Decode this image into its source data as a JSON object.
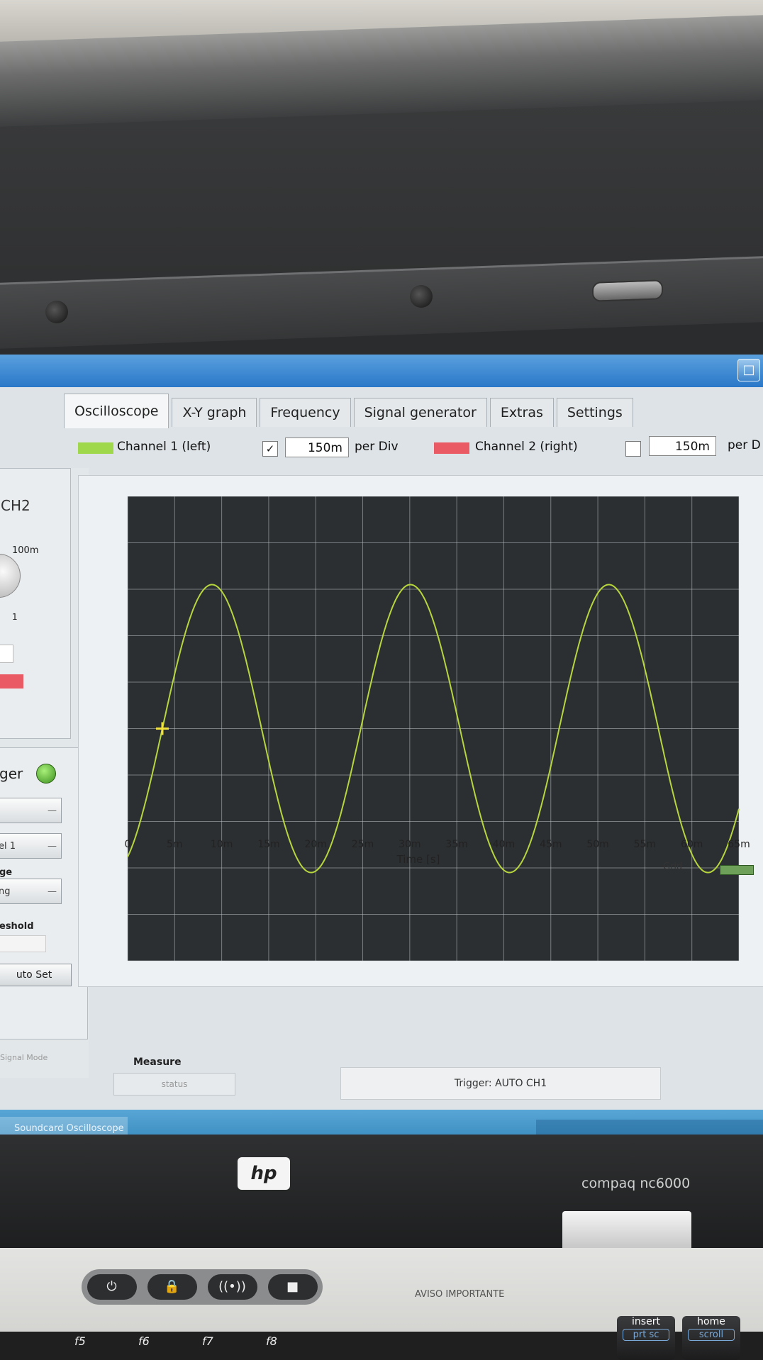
{
  "tabs": [
    "Oscilloscope",
    "X-Y graph",
    "Frequency",
    "Signal generator",
    "Extras",
    "Settings"
  ],
  "toolbar": {
    "ch1_label": "Channel 1 (left)",
    "ch1_checked": "✓",
    "ch1_div": "150m",
    "per_div": "per Div",
    "ch2_label": "Channel 2 (right)",
    "ch2_div": "150m",
    "per_div_cut": "per D"
  },
  "left_panel": {
    "ch2_title": "CH2",
    "knob_max": "100m",
    "knob_min": "1",
    "trigger_title": "ger",
    "trig_select": "el 1",
    "edge_label": "ge",
    "edge_select": "ng",
    "threshold_label": "eshold",
    "auto_set": "uto Set",
    "signal_mode": "Signal Mode"
  },
  "window": {
    "taskbar_item": "Soundcard Oscilloscope",
    "restore_icon": "restore-icon"
  },
  "chart_data": {
    "type": "line",
    "xlabel": "Time [s]",
    "x_ticks": [
      "0",
      "5m",
      "10m",
      "15m",
      "20m",
      "25m",
      "30m",
      "35m",
      "40m",
      "45m",
      "50m",
      "55m",
      "60m",
      "65m"
    ],
    "xlim": [
      0,
      0.065
    ],
    "ylim": [
      -1,
      1
    ],
    "grid": true,
    "grid_label": "Grid",
    "grid_color": "#6fa05a",
    "series": [
      {
        "color": "#b7d63e",
        "frequency_hz": 47.4,
        "amplitude": 0.62,
        "phase_rad": -1.1
      }
    ]
  },
  "status": {
    "measure_label": "Measure",
    "status_text": "status",
    "trigger_text": "Trigger: AUTO  CH1"
  },
  "hardware": {
    "logo": "hp",
    "model": "compaq nc6000",
    "aviso": "AVISO IMPORTANTE",
    "fkeys": [
      "f5",
      "f6",
      "f7",
      "f8"
    ],
    "insert_key": "insert",
    "prtsc_key": "prt sc",
    "home_key": "home",
    "scroll_key": "scroll",
    "quick_buttons": [
      "⏻",
      "🔒",
      "((•))",
      "■"
    ]
  }
}
